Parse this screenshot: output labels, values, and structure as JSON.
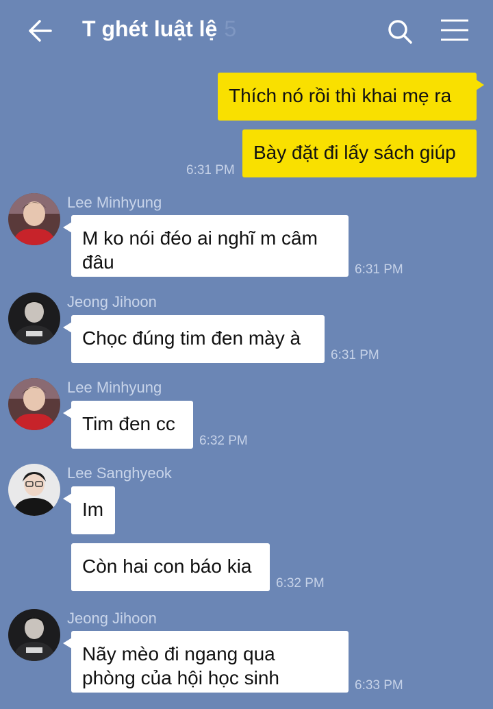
{
  "header": {
    "title": "T ghét luật lệ",
    "member_count": "5",
    "icons": [
      "back-arrow-icon",
      "search-icon",
      "menu-icon"
    ]
  },
  "messages": [
    {
      "sender": "me",
      "text": "Thích nó rồi thì khai mẹ ra"
    },
    {
      "sender": "me",
      "text": "Bày đặt đi lấy sách giúp",
      "time": "6:31 PM"
    },
    {
      "sender": "Lee Minhyung",
      "lines": [
        "M ko nói đéo ai nghĩ m câm",
        "đâu"
      ],
      "time": "6:31 PM"
    },
    {
      "sender": "Jeong Jihoon",
      "text": "Chọc đúng tim đen mày à",
      "time": "6:31 PM"
    },
    {
      "sender": "Lee Minhyung",
      "text": "Tim đen cc",
      "time": "6:32 PM"
    },
    {
      "sender": "Lee Sanghyeok",
      "text": "Im"
    },
    {
      "sender": "Lee Sanghyeok",
      "text": "Còn hai con báo kia",
      "time": "6:32 PM"
    },
    {
      "sender": "Jeong Jihoon",
      "lines": [
        "Nãy mèo đi ngang qua",
        "phòng của hội học sinh"
      ],
      "time": "6:33 PM"
    }
  ],
  "colors": {
    "background": "#6b86b5",
    "my_bubble": "#f9e000",
    "other_bubble": "#ffffff",
    "timestamp": "#c6d2e8",
    "sender_name": "#c9d5ea"
  }
}
